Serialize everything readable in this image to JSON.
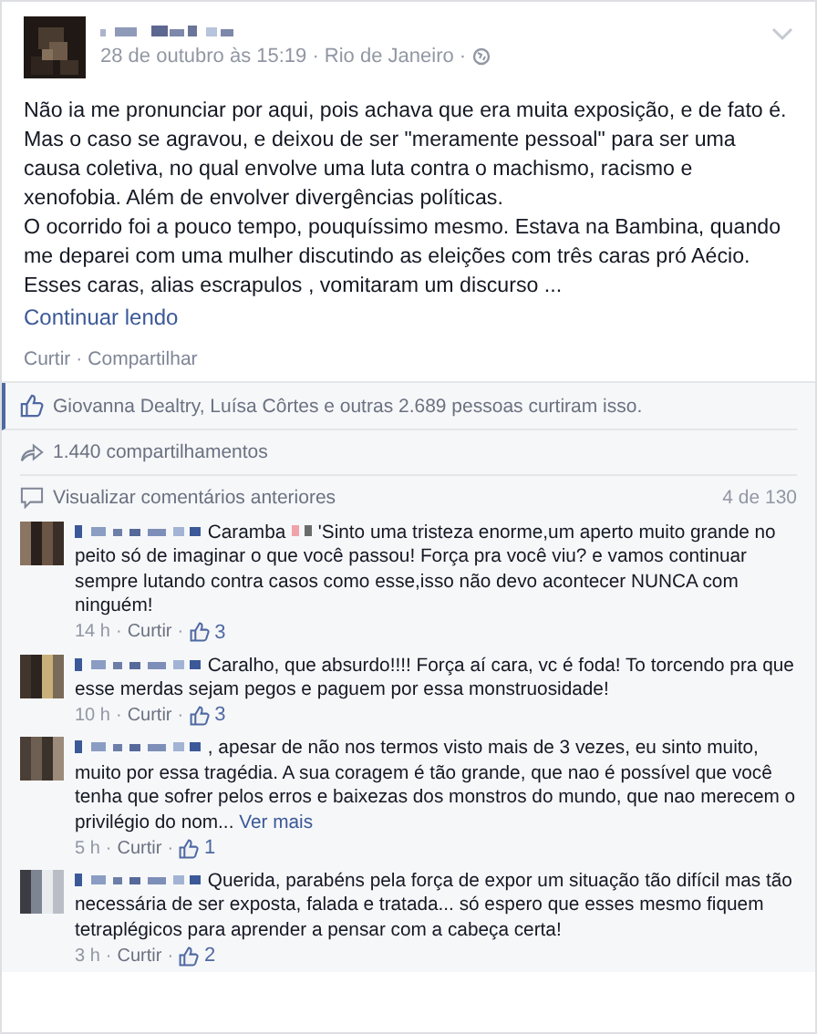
{
  "separator": "·",
  "post": {
    "meta": "28 de outubro às 15:19 · Rio de Janeiro ·",
    "paragraphs": [
      "Não ia me pronunciar por aqui, pois achava que era muita exposição, e de fato é. Mas o caso se agravou, e deixou de ser \"meramente pessoal\" para ser uma causa coletiva, no qual envolve uma luta contra o machismo, racismo e xenofobia. Além de envolver divergências políticas.",
      "O ocorrido foi a pouco tempo, pouquíssimo mesmo. Estava na Bambina, quando me deparei com uma mulher discutindo as eleições com três caras pró Aécio. Esses caras, alias escrapulos , vomitaram um discurso ..."
    ],
    "read_more": "Continuar lendo",
    "actions": [
      "Curtir",
      "Compartilhar"
    ]
  },
  "likes": "Giovanna Dealtry, Luísa Côrtes e outras 2.689 pessoas curtiram isso.",
  "shares": "1.440 compartilhamentos",
  "previous_comments": {
    "label": "Visualizar comentários anteriores",
    "count": "4 de 130"
  },
  "comments": [
    {
      "prefix": "Caramba",
      "text": "'Sinto uma tristeza enorme,um aperto muito grande no peito só de imaginar o que você passou! Força pra você viu? e vamos continuar sempre lutando contra casos como esse,isso não devo acontecer NUNCA com ninguém!",
      "time": "14 h",
      "action": "Curtir",
      "like_count": "3"
    },
    {
      "text": "Caralho, que absurdo!!!! Força aí cara, vc é foda! To torcendo pra que esse merdas sejam pegos e paguem por essa monstruosidade!",
      "time": "10 h",
      "action": "Curtir",
      "like_count": "3"
    },
    {
      "text": ", apesar de não nos termos visto mais de 3 vezes, eu sinto muito, muito por essa tragédia. A sua coragem é tão grande, que nao é possível que você tenha que sofrer pelos erros e baixezas dos monstros do mundo, que nao merecem o privilégio do nom...",
      "more": "Ver mais",
      "time": "5 h",
      "action": "Curtir",
      "like_count": "1"
    },
    {
      "text": "Querida, parabéns pela força de expor um situação tão difícil mas tão necessária de ser exposta, falada e tratada... só espero que esses mesmo fiquem tetraplégicos para aprender a pensar com a cabeça certa!",
      "time": "3 h",
      "action": "Curtir",
      "like_count": "2"
    }
  ]
}
